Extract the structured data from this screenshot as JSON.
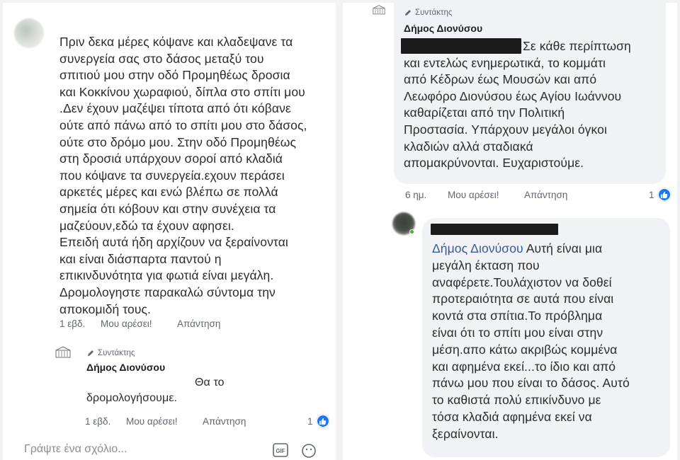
{
  "left_panel": {
    "comment1": {
      "author_redacted": true,
      "lines": [
        "Πριν δεκα μέρες κόψανε και κλαδεψανε τα",
        "συνεργεία σας στο δάσος μεταξύ του",
        "σπιτιού μου στην οδό Προμηθέως δροσια",
        "και Κοκκίνου χωραφιού, δίπλα στο σπίτι μου",
        ".Δεν έχουν μαζέψει τίποτα από ότι κόβανε",
        "ούτε από πάνω από το σπίτι μου στο δάσος,",
        "ούτε στο δρόμο μου. Στην οδό Προμηθέως",
        "στη δροσιά υπάρχουν σοροί από κλαδιά",
        "που κόψανε τα συνεργεία.εχουν περάσει",
        "αρκετές μέρες και ενώ βλέπω σε πολλά",
        "σημεία ότι κόβουν και στην συνέχεια τα",
        "μαζεύουν,εδώ τα έχουν αφησει.",
        "Επειδή αυτά ήδη αρχίζουν να ξεραίνονται",
        "και είναι διάσπαρτα παντού η",
        "επικινδυνότητα για φωτιά είναι μεγάλη.",
        "Δρομολογηστε παρακαλώ σύντομα την",
        "αποκομιδή τους."
      ],
      "time": "1 εβδ.",
      "like_label": "Μου αρέσει!",
      "reply_label": "Απάντηση"
    },
    "reply1": {
      "role": "Συντάκτης",
      "author": "Δήμος Διονύσου",
      "lines": [
        "Θα το",
        "δρομολογήσουμε."
      ],
      "time": "1 εβδ.",
      "like_label": "Μου αρέσει!",
      "reply_label": "Απάντηση",
      "likes": "1"
    },
    "compose": {
      "placeholder": "Γράψτε ένα σχόλιο...",
      "gif_label": "GIF"
    }
  },
  "right_panel": {
    "reply_top": {
      "role": "Συντάκτης",
      "author": "Δήμος Διονύσου",
      "lines": [
        "Σε κάθε περίπτωση",
        "και εντελώς ενημερωτικά, το κομμάτι",
        "από Κέδρων έως Μουσών και από",
        "Λεωφόρο Διονύσου έως Αγίου Ιωάννου",
        "καθαρίζεται από την Πολιτική",
        "Προστασία. Υπάρχουν μεγάλοι όγκοι",
        "κλαδιών αλλά σταδιακά",
        "απομακρύνονται. Ευχαριστούμε."
      ],
      "time": "6 ημ.",
      "like_label": "Μου αρέσει!",
      "reply_label": "Απάντηση",
      "likes": "1"
    },
    "comment2": {
      "mention": "Δήμος Διονύσου",
      "first_line_rest": " Αυτή είναι μια",
      "lines": [
        "μεγάλη έκταση που",
        "αναφέρετε.Τουλάχιστον να δοθεί",
        "προτεραιότητα σε αυτά που είναι",
        "κοντά στα σπίτια.Το πρόβλημα",
        "είναι ότι το σπίτι μου είναι στην",
        "μέση.απο κάτω ακριβώς κομμένα",
        "και αφημένα εκεί...το ίδιο και από",
        "πάνω μου που είναι το δάσος. Αυτό",
        "το καθιστά πολύ επικίνδυνο με",
        "τόσα κλαδιά αφημένα εκεί να",
        "ξεραίνονται."
      ]
    }
  },
  "colors": {
    "bubble": "#f0f2f5",
    "like_blue": "#1877f2",
    "mention": "#385898",
    "meta_text": "#606770"
  }
}
